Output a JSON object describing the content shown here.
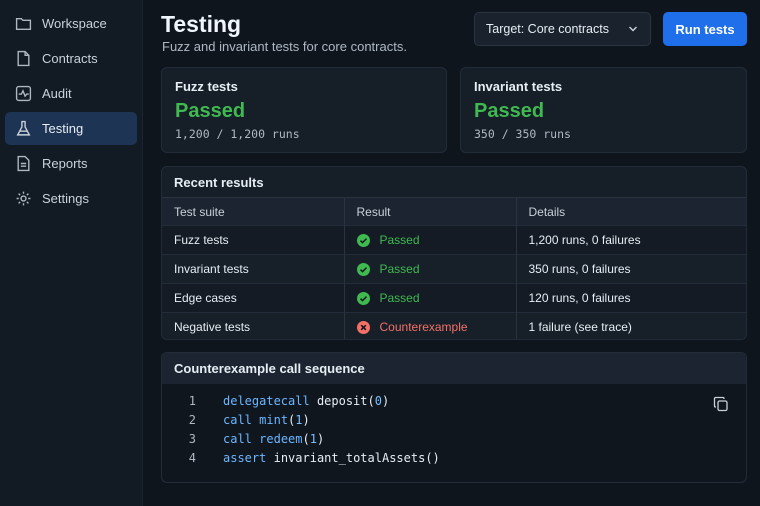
{
  "sidebar": {
    "items": [
      {
        "label": "Workspace",
        "icon": "folder-icon"
      },
      {
        "label": "Contracts",
        "icon": "file-icon"
      },
      {
        "label": "Audit",
        "icon": "pulse-icon"
      },
      {
        "label": "Testing",
        "icon": "flask-icon",
        "active": true
      },
      {
        "label": "Reports",
        "icon": "document-icon"
      },
      {
        "label": "Settings",
        "icon": "gear-icon"
      }
    ]
  },
  "header": {
    "title": "Testing",
    "subtitle": "Fuzz and invariant tests for core contracts.",
    "target_select": "Target: Core contracts",
    "run_button": "Run tests"
  },
  "stats": {
    "fuzz": {
      "title": "Fuzz tests",
      "status": "Passed",
      "runs": "1,200 / 1,200 runs"
    },
    "invariant": {
      "title": "Invariant tests",
      "status": "Passed",
      "runs": "350 / 350 runs"
    }
  },
  "results": {
    "title": "Recent results",
    "columns": [
      "Test suite",
      "Result",
      "Details"
    ],
    "rows": [
      {
        "suite": "Fuzz tests",
        "result": "Passed",
        "status": "pass",
        "details": "1,200 runs, 0 failures"
      },
      {
        "suite": "Invariant tests",
        "result": "Passed",
        "status": "pass",
        "details": "350 runs, 0 failures"
      },
      {
        "suite": "Edge cases",
        "result": "Passed",
        "status": "pass",
        "details": "120 runs, 0 failures"
      },
      {
        "suite": "Negative tests",
        "result": "Counterexample",
        "status": "fail",
        "details": "1 failure (see trace)"
      }
    ]
  },
  "counterexample": {
    "title": "Counterexample call sequence",
    "lines": [
      {
        "n": "1",
        "kw": "delegatecall",
        "fn": "deposit",
        "arg": "0"
      },
      {
        "n": "2",
        "kw": "call",
        "fn": "mint",
        "arg": "1"
      },
      {
        "n": "3",
        "kw": "call",
        "fn": "redeem",
        "arg": "1"
      },
      {
        "n": "4",
        "kw": "assert",
        "fn": "invariant_totalAssets",
        "arg": ""
      }
    ]
  },
  "colors": {
    "accent": "#1f6feb",
    "pass": "#3fb950",
    "fail": "#f47067",
    "keyword": "#6cb6ff"
  }
}
